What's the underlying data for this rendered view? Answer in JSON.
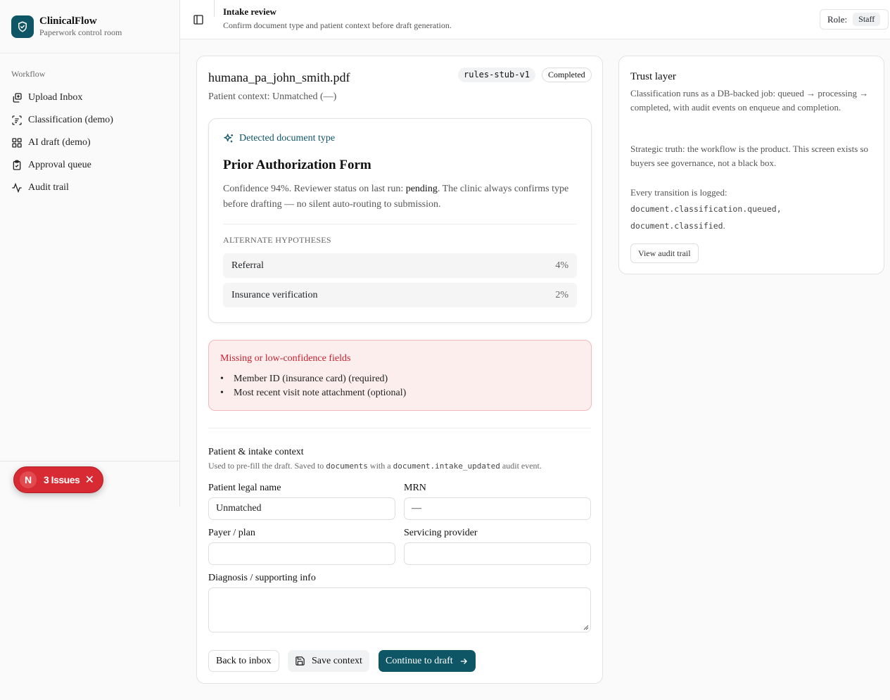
{
  "brand": {
    "title": "ClinicalFlow",
    "subtitle": "Paperwork control room"
  },
  "sidebar": {
    "heading": "Workflow",
    "items": [
      {
        "label": "Upload Inbox",
        "icon": "upload-icon"
      },
      {
        "label": "Classification (demo)",
        "icon": "list-scan-icon"
      },
      {
        "label": "AI draft (demo)",
        "icon": "grid-icon"
      },
      {
        "label": "Approval queue",
        "icon": "clipboard-check-icon"
      },
      {
        "label": "Audit trail",
        "icon": "activity-icon"
      }
    ]
  },
  "issues": {
    "letter": "N",
    "label": "3 Issues",
    "close": "✕"
  },
  "header": {
    "title": "Intake review",
    "subtitle": "Confirm document type and patient context before draft generation.",
    "role_label": "Role:",
    "role_value": "Staff"
  },
  "document": {
    "file_name": "humana_pa_john_smith.pdf",
    "patient_context": "Patient context: Unmatched (—)",
    "rules_badge": "rules-stub-v1",
    "status_badge": "Completed"
  },
  "detection": {
    "label": "Detected document type",
    "type": "Prior Authorization Form",
    "desc_before": "Confidence 94%. Reviewer status on last run: ",
    "desc_status": "pending",
    "desc_after": ". The clinic always confirms type before drafting — no silent auto-routing to submission.",
    "alt_heading": "ALTERNATE HYPOTHESES",
    "alternates": [
      {
        "label": "Referral",
        "pct": "4%"
      },
      {
        "label": "Insurance verification",
        "pct": "2%"
      }
    ]
  },
  "warning": {
    "title": "Missing or low-confidence fields",
    "items": [
      "Member ID (insurance card) (required)",
      "Most recent visit note attachment (optional)"
    ]
  },
  "context": {
    "title": "Patient & intake context",
    "sub_before": "Used to pre-fill the draft. Saved to ",
    "sub_code1": "documents",
    "sub_mid": " with a ",
    "sub_code2": "document.intake_updated",
    "sub_after": " audit event.",
    "fields": {
      "patient_name_label": "Patient legal name",
      "patient_name_value": "Unmatched",
      "mrn_label": "MRN",
      "mrn_value": "—",
      "payer_label": "Payer / plan",
      "payer_value": "",
      "provider_label": "Servicing provider",
      "provider_value": "",
      "diagnosis_label": "Diagnosis / supporting info",
      "diagnosis_value": ""
    }
  },
  "actions": {
    "back": "Back to inbox",
    "save": "Save context",
    "continue": "Continue to draft"
  },
  "trust": {
    "title": "Trust layer",
    "p1": "Classification runs as a DB-backed job: queued → processing → completed, with audit events on enqueue and completion.",
    "p2": "Strategic truth: the workflow is the product. This screen exists so buyers see governance, not a black box.",
    "p3": "Every transition is logged:",
    "code1": "document.classification.queued,",
    "code2": "document.classified",
    "code2_suffix": ".",
    "button": "View audit trail"
  },
  "colors": {
    "brand": "#0e5566",
    "danger": "#c8202e",
    "issues_bg": "#d72a33"
  }
}
